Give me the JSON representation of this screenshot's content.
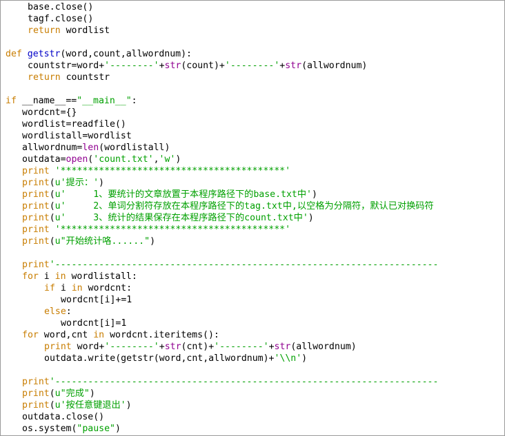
{
  "colors": {
    "keyword": "#c87d00",
    "builtin": "#900090",
    "string": "#00a000",
    "defname": "#0000c8",
    "text": "#000000",
    "background": "#ffffff"
  },
  "lines": [
    {
      "indent": 4,
      "tokens": [
        {
          "t": "",
          "v": "base.close()"
        }
      ]
    },
    {
      "indent": 4,
      "tokens": [
        {
          "t": "",
          "v": "tagf.close()"
        }
      ]
    },
    {
      "indent": 4,
      "tokens": [
        {
          "t": "kw",
          "v": "return"
        },
        {
          "t": "",
          "v": " wordlist"
        }
      ]
    },
    {
      "indent": 0,
      "tokens": []
    },
    {
      "indent": 0,
      "tokens": [
        {
          "t": "kw",
          "v": "def"
        },
        {
          "t": "",
          "v": " "
        },
        {
          "t": "df",
          "v": "getstr"
        },
        {
          "t": "",
          "v": "(word,count,allwordnum):"
        }
      ]
    },
    {
      "indent": 4,
      "tokens": [
        {
          "t": "",
          "v": "countstr=word+"
        },
        {
          "t": "st",
          "v": "'--------'"
        },
        {
          "t": "",
          "v": "+"
        },
        {
          "t": "bi",
          "v": "str"
        },
        {
          "t": "",
          "v": "(count)+"
        },
        {
          "t": "st",
          "v": "'--------'"
        },
        {
          "t": "",
          "v": "+"
        },
        {
          "t": "bi",
          "v": "str"
        },
        {
          "t": "",
          "v": "(allwordnum)"
        }
      ]
    },
    {
      "indent": 4,
      "tokens": [
        {
          "t": "kw",
          "v": "return"
        },
        {
          "t": "",
          "v": " countstr"
        }
      ]
    },
    {
      "indent": 0,
      "tokens": []
    },
    {
      "indent": 0,
      "tokens": [
        {
          "t": "kw",
          "v": "if"
        },
        {
          "t": "",
          "v": " __name__=="
        },
        {
          "t": "st",
          "v": "\"__main__\""
        },
        {
          "t": "",
          "v": ":"
        }
      ]
    },
    {
      "indent": 3,
      "tokens": [
        {
          "t": "",
          "v": "wordcnt={}"
        }
      ]
    },
    {
      "indent": 3,
      "tokens": [
        {
          "t": "",
          "v": "wordlist=readfile()"
        }
      ]
    },
    {
      "indent": 3,
      "tokens": [
        {
          "t": "",
          "v": "wordlistall=wordlist"
        }
      ]
    },
    {
      "indent": 3,
      "tokens": [
        {
          "t": "",
          "v": "allwordnum="
        },
        {
          "t": "bi",
          "v": "len"
        },
        {
          "t": "",
          "v": "(wordlistall)"
        }
      ]
    },
    {
      "indent": 3,
      "tokens": [
        {
          "t": "",
          "v": "outdata="
        },
        {
          "t": "bi",
          "v": "open"
        },
        {
          "t": "",
          "v": "("
        },
        {
          "t": "st",
          "v": "'count.txt'"
        },
        {
          "t": "",
          "v": ","
        },
        {
          "t": "st",
          "v": "'w'"
        },
        {
          "t": "",
          "v": ")"
        }
      ]
    },
    {
      "indent": 3,
      "tokens": [
        {
          "t": "kw",
          "v": "print"
        },
        {
          "t": "",
          "v": " "
        },
        {
          "t": "st",
          "v": "'*****************************************'"
        }
      ]
    },
    {
      "indent": 3,
      "tokens": [
        {
          "t": "kw",
          "v": "print"
        },
        {
          "t": "",
          "v": "("
        },
        {
          "t": "st",
          "v": "u'提示：'"
        },
        {
          "t": "",
          "v": ")"
        }
      ]
    },
    {
      "indent": 3,
      "tokens": [
        {
          "t": "kw",
          "v": "print"
        },
        {
          "t": "",
          "v": "("
        },
        {
          "t": "st",
          "v": "u'     1、要统计的文章放置于本程序路径下的base.txt中'"
        },
        {
          "t": "",
          "v": ")"
        }
      ]
    },
    {
      "indent": 3,
      "tokens": [
        {
          "t": "kw",
          "v": "print"
        },
        {
          "t": "",
          "v": "("
        },
        {
          "t": "st",
          "v": "u'     2、单词分割符存放在本程序路径下的tag.txt中,以空格为分隔符，默认已对换码符"
        }
      ]
    },
    {
      "indent": 3,
      "tokens": [
        {
          "t": "kw",
          "v": "print"
        },
        {
          "t": "",
          "v": "("
        },
        {
          "t": "st",
          "v": "u'     3、统计的结果保存在本程序路径下的count.txt中'"
        },
        {
          "t": "",
          "v": ")"
        }
      ]
    },
    {
      "indent": 3,
      "tokens": [
        {
          "t": "kw",
          "v": "print"
        },
        {
          "t": "",
          "v": " "
        },
        {
          "t": "st",
          "v": "'*****************************************'"
        }
      ]
    },
    {
      "indent": 3,
      "tokens": [
        {
          "t": "kw",
          "v": "print"
        },
        {
          "t": "",
          "v": "("
        },
        {
          "t": "st",
          "v": "u\"开始统计咯......\""
        },
        {
          "t": "",
          "v": ")"
        }
      ]
    },
    {
      "indent": 0,
      "tokens": []
    },
    {
      "indent": 3,
      "tokens": [
        {
          "t": "kw",
          "v": "print"
        },
        {
          "t": "st",
          "v": "'----------------------------------------------------------------------"
        }
      ]
    },
    {
      "indent": 3,
      "tokens": [
        {
          "t": "kw",
          "v": "for"
        },
        {
          "t": "",
          "v": " i "
        },
        {
          "t": "kw",
          "v": "in"
        },
        {
          "t": "",
          "v": " wordlistall:"
        }
      ]
    },
    {
      "indent": 7,
      "tokens": [
        {
          "t": "kw",
          "v": "if"
        },
        {
          "t": "",
          "v": " i "
        },
        {
          "t": "kw",
          "v": "in"
        },
        {
          "t": "",
          "v": " wordcnt:"
        }
      ]
    },
    {
      "indent": 10,
      "tokens": [
        {
          "t": "",
          "v": "wordcnt[i]+=1"
        }
      ]
    },
    {
      "indent": 7,
      "tokens": [
        {
          "t": "kw",
          "v": "else"
        },
        {
          "t": "",
          "v": ":"
        }
      ]
    },
    {
      "indent": 10,
      "tokens": [
        {
          "t": "",
          "v": "wordcnt[i]=1"
        }
      ]
    },
    {
      "indent": 3,
      "tokens": [
        {
          "t": "kw",
          "v": "for"
        },
        {
          "t": "",
          "v": " word,cnt "
        },
        {
          "t": "kw",
          "v": "in"
        },
        {
          "t": "",
          "v": " wordcnt.iteritems():"
        }
      ]
    },
    {
      "indent": 7,
      "tokens": [
        {
          "t": "kw",
          "v": "print"
        },
        {
          "t": "",
          "v": " word+"
        },
        {
          "t": "st",
          "v": "'--------'"
        },
        {
          "t": "",
          "v": "+"
        },
        {
          "t": "bi",
          "v": "str"
        },
        {
          "t": "",
          "v": "(cnt)+"
        },
        {
          "t": "st",
          "v": "'--------'"
        },
        {
          "t": "",
          "v": "+"
        },
        {
          "t": "bi",
          "v": "str"
        },
        {
          "t": "",
          "v": "(allwordnum)"
        }
      ]
    },
    {
      "indent": 7,
      "tokens": [
        {
          "t": "",
          "v": "outdata.write(getstr(word,cnt,allwordnum)+"
        },
        {
          "t": "st",
          "v": "'\\\\n'"
        },
        {
          "t": "",
          "v": ")"
        }
      ]
    },
    {
      "indent": 0,
      "tokens": []
    },
    {
      "indent": 3,
      "tokens": [
        {
          "t": "kw",
          "v": "print"
        },
        {
          "t": "st",
          "v": "'----------------------------------------------------------------------"
        }
      ]
    },
    {
      "indent": 3,
      "tokens": [
        {
          "t": "kw",
          "v": "print"
        },
        {
          "t": "",
          "v": "("
        },
        {
          "t": "st",
          "v": "u\"完成\""
        },
        {
          "t": "",
          "v": ")"
        }
      ]
    },
    {
      "indent": 3,
      "tokens": [
        {
          "t": "kw",
          "v": "print"
        },
        {
          "t": "",
          "v": "("
        },
        {
          "t": "st",
          "v": "u'按任意键退出'"
        },
        {
          "t": "",
          "v": ")"
        }
      ]
    },
    {
      "indent": 3,
      "tokens": [
        {
          "t": "",
          "v": "outdata.close()"
        }
      ]
    },
    {
      "indent": 3,
      "tokens": [
        {
          "t": "",
          "v": "os.system("
        },
        {
          "t": "st",
          "v": "\"pause\""
        },
        {
          "t": "",
          "v": ")"
        }
      ]
    }
  ]
}
